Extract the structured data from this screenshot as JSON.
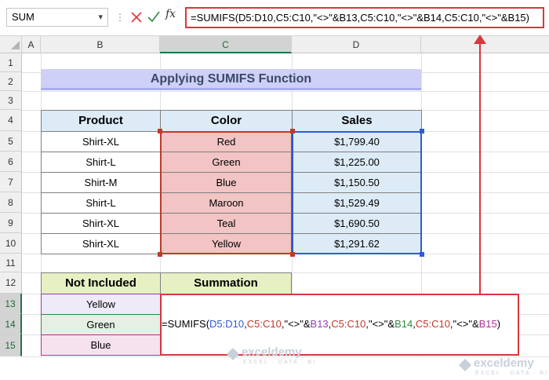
{
  "formula_bar": {
    "name_box": "SUM",
    "fx_label": "fx",
    "formula": "=SUMIFS(D5:D10,C5:C10,\"<>\"&B13,C5:C10,\"<>\"&B14,C5:C10,\"<>\"&B15)"
  },
  "columns": [
    "A",
    "B",
    "C",
    "D"
  ],
  "rows": [
    "1",
    "2",
    "3",
    "4",
    "5",
    "6",
    "7",
    "8",
    "9",
    "10",
    "11",
    "12",
    "13",
    "14",
    "15"
  ],
  "sheet": {
    "title": "Applying SUMIFS Function",
    "table": {
      "headers": [
        "Product",
        "Color",
        "Sales"
      ],
      "rows": [
        [
          "Shirt-XL",
          "Red",
          "$1,799.40"
        ],
        [
          "Shirt-L",
          "Green",
          "$1,225.00"
        ],
        [
          "Shirt-M",
          "Blue",
          "$1,150.50"
        ],
        [
          "Shirt-L",
          "Maroon",
          "$1,529.49"
        ],
        [
          "Shirt-XL",
          "Teal",
          "$1,690.50"
        ],
        [
          "Shirt-XL",
          "Yellow",
          "$1,291.62"
        ]
      ]
    },
    "not_included": {
      "header": "Not Included",
      "items": [
        "Yellow",
        "Green",
        "Blue"
      ]
    },
    "summation": {
      "header": "Summation",
      "formula_parts": [
        "=SUMIFS(",
        "D5:D10",
        ",",
        "C5:C10",
        ",\"<>\"&",
        "B13",
        ",",
        "C5:C10",
        ",\"<>\"&",
        "B14",
        ",",
        "C5:C10",
        ",\"<>\"&",
        "B15",
        ")"
      ]
    }
  },
  "watermark": {
    "name": "exceldemy",
    "tagline": "EXCEL · DATA · BI"
  },
  "colors": {
    "accent_red": "#d9363e",
    "excel_green": "#217346"
  }
}
